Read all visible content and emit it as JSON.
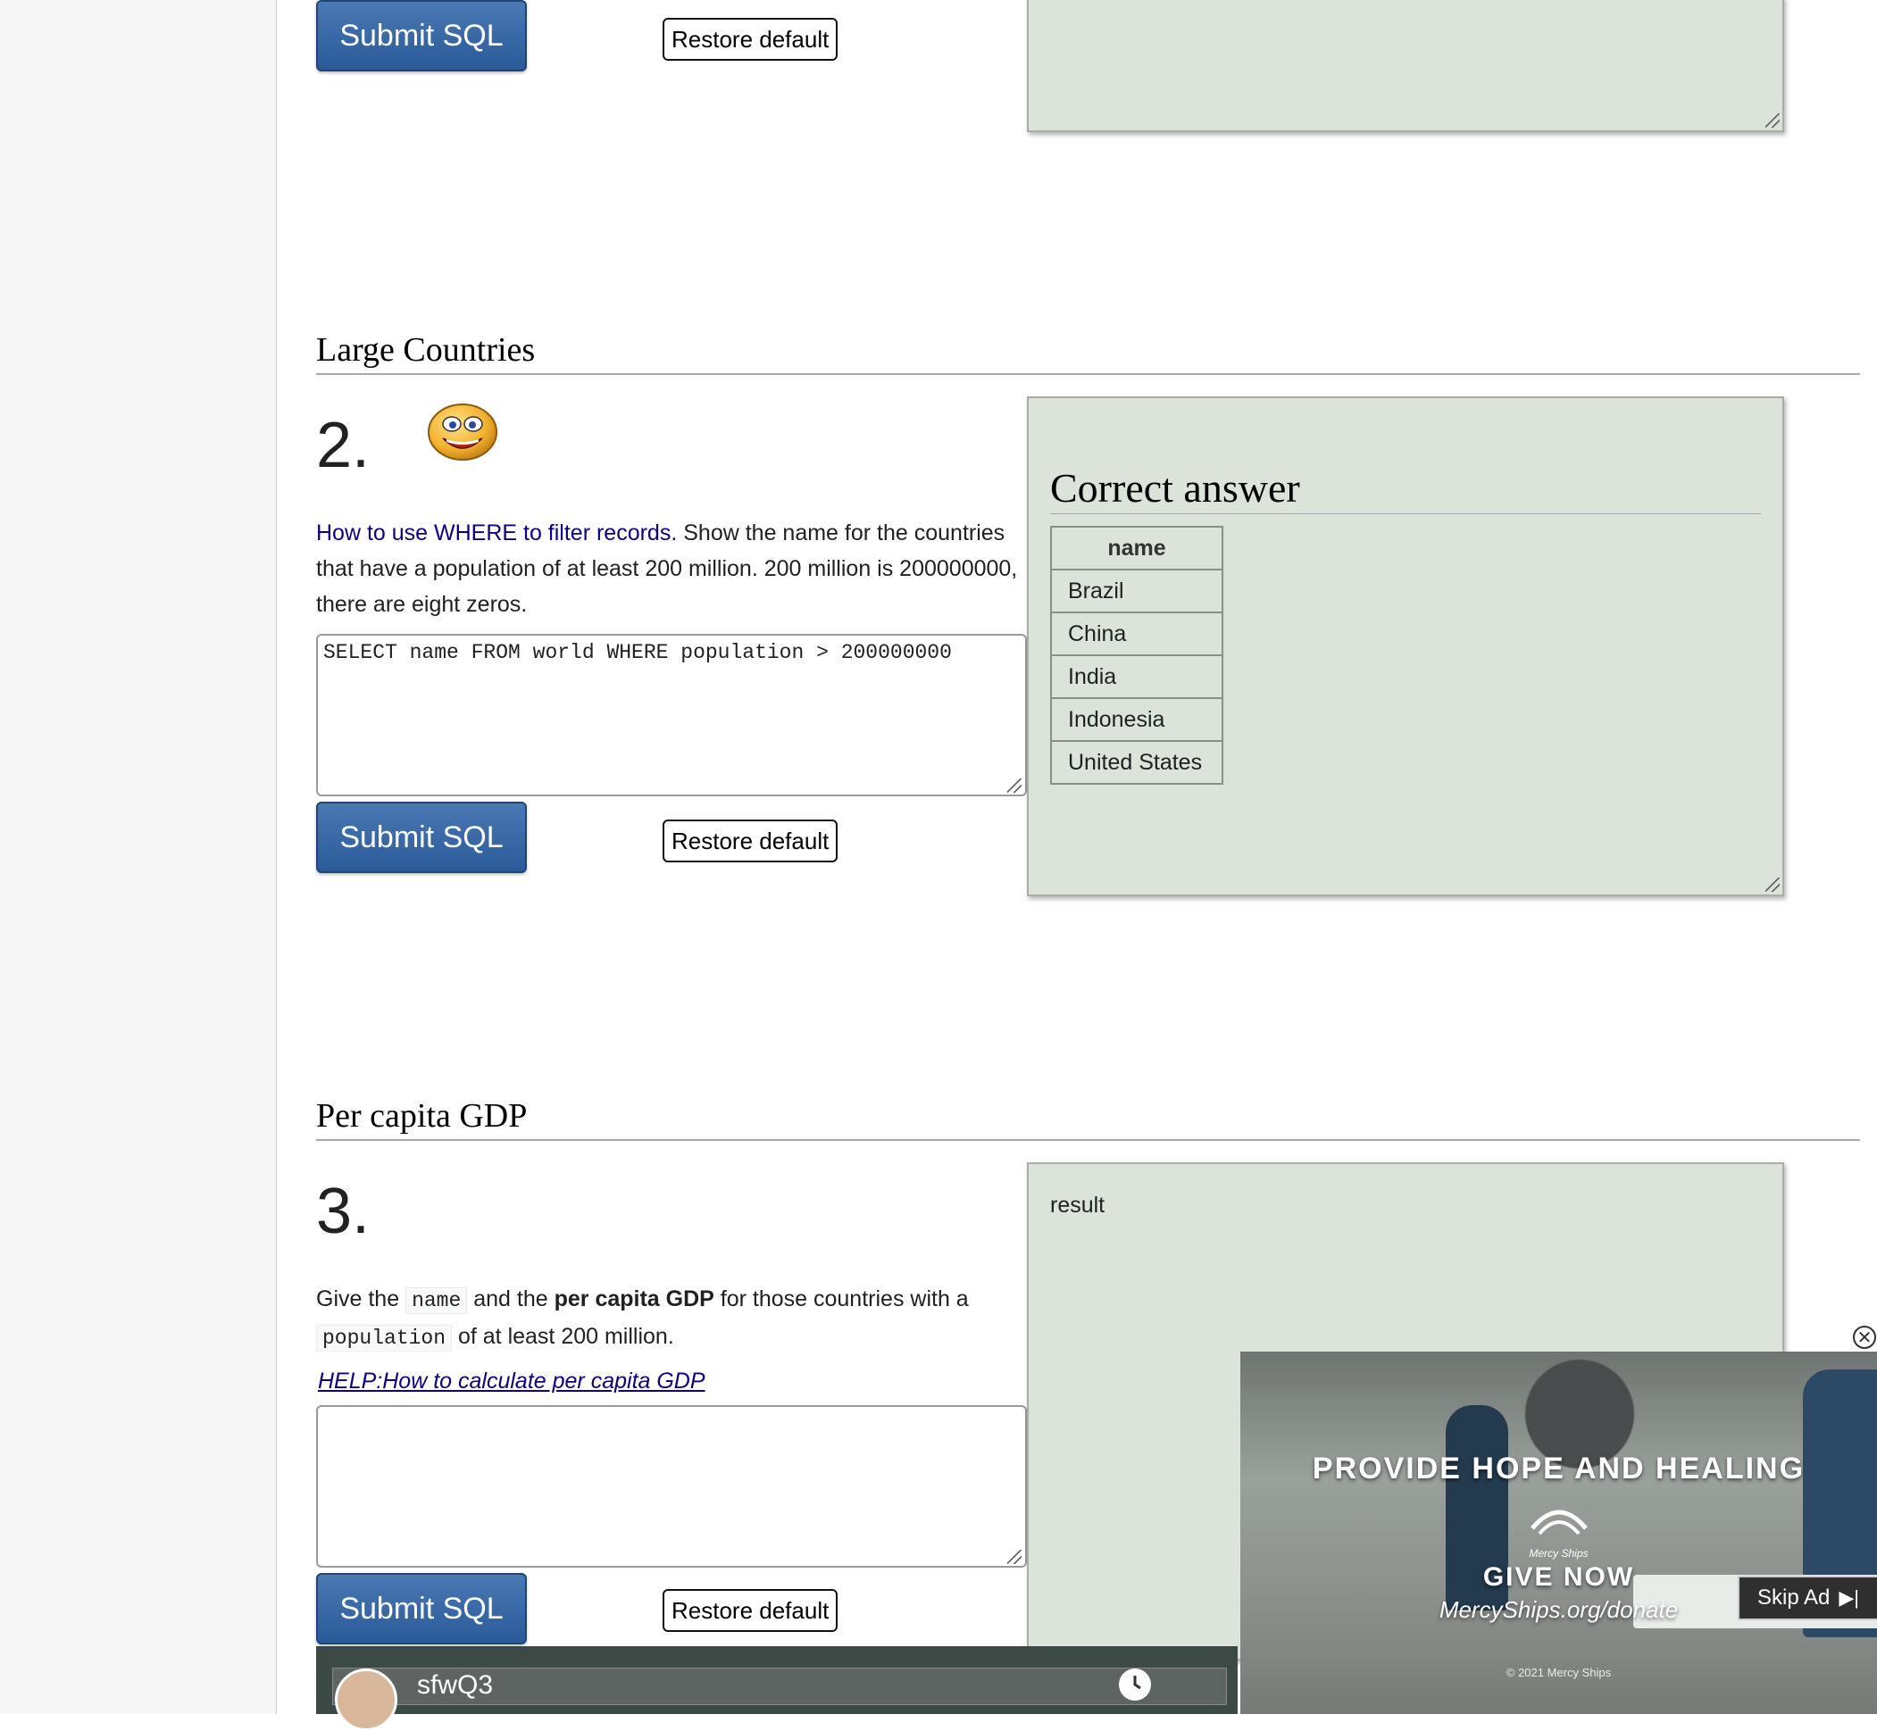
{
  "q1": {
    "submit_label": "Submit SQL",
    "restore_label": "Restore default"
  },
  "q2": {
    "heading": "Large Countries",
    "number": "2.",
    "link_text": "How to use WHERE to filter records.",
    "text": " Show the name for the countries that have a population of at least 200 million. 200 million is 200000000, there are eight zeros.",
    "sql": "SELECT name FROM world WHERE population > 200000000",
    "submit_label": "Submit SQL",
    "restore_label": "Restore default",
    "answer_title": "Correct answer",
    "column_header": "name",
    "rows": [
      "Brazil",
      "China",
      "India",
      "Indonesia",
      "United States"
    ]
  },
  "q3": {
    "heading": "Per capita GDP",
    "number": "3.",
    "text_1": "Give the ",
    "code_1": "name",
    "text_2": " and the ",
    "bold": "per capita GDP",
    "text_3": " for those countries with a ",
    "code_2": "population",
    "text_4": " of at least 200 million.",
    "help_link": "HELP:How to calculate per capita GDP",
    "sql": "",
    "submit_label": "Submit SQL",
    "restore_label": "Restore default",
    "result_label": "result"
  },
  "video": {
    "title": "sfwQ3"
  },
  "ad": {
    "headline": "PROVIDE HOPE AND HEALING",
    "logo_text": "Mercy Ships",
    "cta": "GIVE NOW",
    "url": "MercyShips.org/donate",
    "copyright": "© 2021 Mercy Ships",
    "skip_label": "Skip Ad"
  }
}
